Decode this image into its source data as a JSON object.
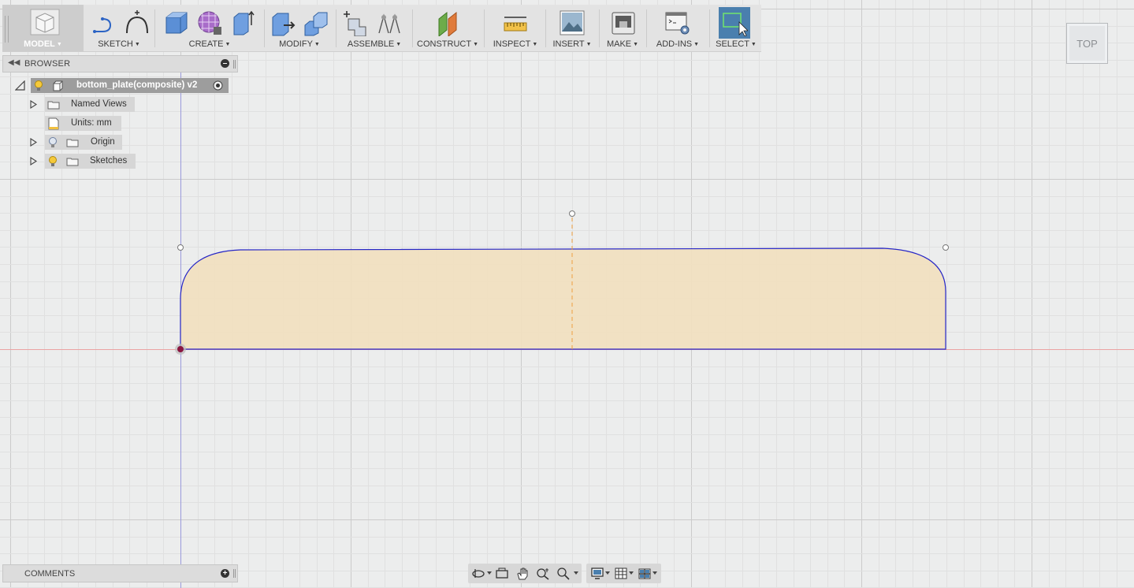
{
  "toolbar": {
    "model_label": "MODEL",
    "sketch_label": "SKETCH",
    "create_label": "CREATE",
    "modify_label": "MODIFY",
    "assemble_label": "ASSEMBLE",
    "construct_label": "CONSTRUCT",
    "inspect_label": "INSPECT",
    "insert_label": "INSERT",
    "make_label": "MAKE",
    "addins_label": "ADD-INS",
    "select_label": "SELECT"
  },
  "browser": {
    "title": "BROWSER",
    "root": {
      "label": "bottom_plate(composite) v2"
    },
    "items": [
      {
        "label": "Named Views",
        "icon": "folder-icon",
        "expandable": true
      },
      {
        "label": "Units: mm",
        "icon": "units-icon",
        "expandable": false
      },
      {
        "label": "Origin",
        "icon": "folder-icon",
        "expandable": true,
        "bulb": "off"
      },
      {
        "label": "Sketches",
        "icon": "folder-icon",
        "expandable": true,
        "bulb": "on"
      }
    ]
  },
  "comments": {
    "title": "COMMENTS"
  },
  "viewcube": {
    "face": "TOP"
  },
  "colors": {
    "canvas": "#eceded",
    "profile_fill": "#f1dfbf",
    "profile_stroke": "#2424c8",
    "x_axis": "#e8a0a0",
    "y_axis": "#8f8fd8",
    "centerline": "#f0a040",
    "select_active": "#4a7fae"
  }
}
